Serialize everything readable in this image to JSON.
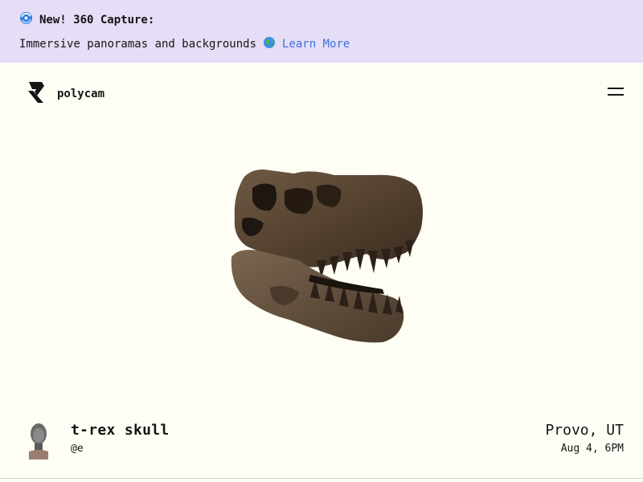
{
  "banner": {
    "icon": "capture-360-icon",
    "headline": "New! 360 Capture:",
    "description": "Immersive panoramas and backgrounds",
    "globe_icon": "globe-icon",
    "link_label": "Learn More",
    "background_color": "#e6ddf6",
    "link_color": "#3f6fd8"
  },
  "header": {
    "logo_icon": "polycam-logo-icon",
    "logo_text": "polycam",
    "menu_icon": "hamburger-menu-icon"
  },
  "capture": {
    "subject": "t-rex skull",
    "username": "@e",
    "location": "Provo, UT",
    "date": "Aug 4, 6PM",
    "avatar": "user-avatar"
  },
  "colors": {
    "page_background": "#fffef5",
    "text": "#151515"
  }
}
